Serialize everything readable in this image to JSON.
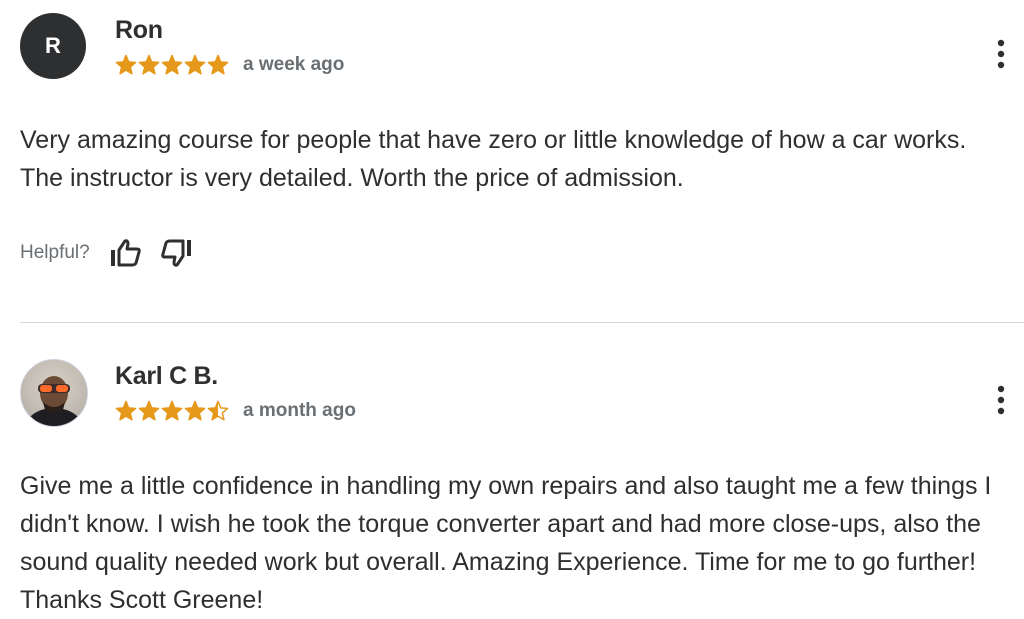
{
  "colors": {
    "text": "#2d2f31",
    "muted": "#6a6f73",
    "star": "#e59819",
    "avatar_bg": "#2d2f31",
    "divider": "#d1d7dc"
  },
  "reviews": [
    {
      "author": "Ron",
      "avatar_initial": "R",
      "rating": 5,
      "date": "a week ago",
      "text": "Very amazing course for people that have zero or little knowledge of how a car works. The instructor is very detailed. Worth the price of admission.",
      "helpful_label": "Helpful?",
      "icons": {
        "like": "thumbs-up-icon",
        "dislike": "thumbs-down-icon",
        "menu": "more-vertical-icon"
      }
    },
    {
      "author": "Karl C B.",
      "avatar_initial": "",
      "rating": 4.5,
      "date": "a month ago",
      "text": "Give me a little confidence in handling my own repairs and also taught me a few things I didn't know. I wish he took the torque converter apart and had more close-ups, also the sound quality needed work but overall. Amazing Experience. Time for me to go further! Thanks Scott Greene!",
      "icons": {
        "menu": "more-vertical-icon"
      }
    }
  ]
}
